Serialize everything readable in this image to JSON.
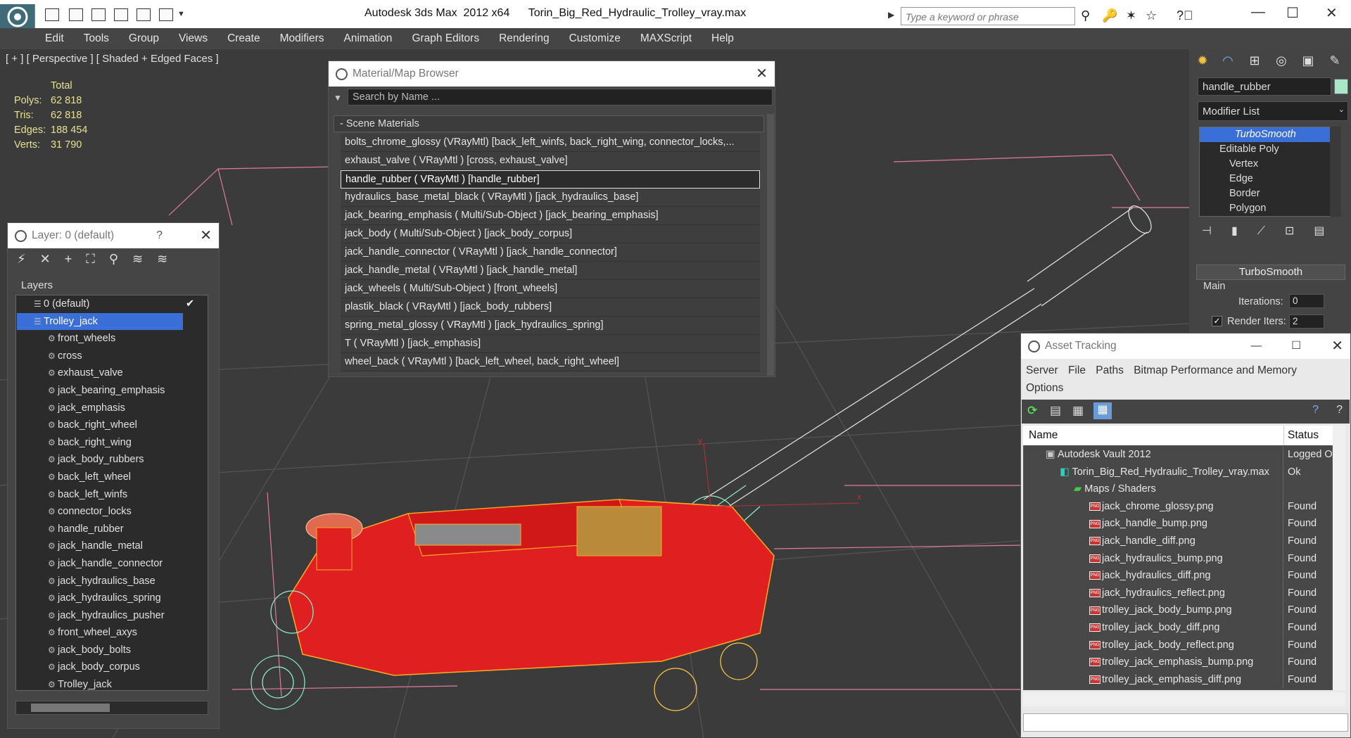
{
  "titlebar": {
    "title": "Autodesk 3ds Max  2012 x64      Torin_Big_Red_Hydraulic_Trolley_vray.max",
    "search_placeholder": "Type a keyword or phrase"
  },
  "menu": [
    "Edit",
    "Tools",
    "Group",
    "Views",
    "Create",
    "Modifiers",
    "Animation",
    "Graph Editors",
    "Rendering",
    "Customize",
    "MAXScript",
    "Help"
  ],
  "viewport": {
    "label": "[ + ] [ Perspective ] [ Shaded + Edged Faces ]",
    "stats_header": "Total",
    "stats": [
      {
        "label": "Polys:",
        "value": "62 818"
      },
      {
        "label": "Tris:",
        "value": "62 818"
      },
      {
        "label": "Edges:",
        "value": "188 454"
      },
      {
        "label": "Verts:",
        "value": "31 790"
      }
    ],
    "axis_x": "x",
    "axis_y": "y"
  },
  "command_panel": {
    "object_name": "handle_rubber",
    "modifier_list": "Modifier List",
    "stack": [
      {
        "label": "TurboSmooth",
        "selected": true
      },
      {
        "label": "Editable Poly",
        "selected": false
      },
      {
        "label": "Vertex",
        "selected": false
      },
      {
        "label": "Edge",
        "selected": false
      },
      {
        "label": "Border",
        "selected": false
      },
      {
        "label": "Polygon",
        "selected": false
      }
    ],
    "rollout_title": "TurboSmooth",
    "group_main": "Main",
    "iterations_label": "Iterations:",
    "iterations_value": "0",
    "render_iters_label": "Render Iters:",
    "render_iters_value": "2"
  },
  "material_browser": {
    "title": "Material/Map Browser",
    "search_placeholder": "Search by Name ...",
    "section": "- Scene Materials",
    "items": [
      "bolts_chrome_glossy (VRayMtl) [back_left_winfs, back_right_wing, connector_locks,...",
      "exhaust_valve  ( VRayMtl ) [cross, exhaust_valve]",
      "handle_rubber  ( VRayMtl ) [handle_rubber]",
      "hydraulics_base_metal_black  ( VRayMtl ) [jack_hydraulics_base]",
      "jack_bearing_emphasis  ( Multi/Sub-Object ) [jack_bearing_emphasis]",
      "jack_body  ( Multi/Sub-Object ) [jack_body_corpus]",
      "jack_handle_connector  ( VRayMtl ) [jack_handle_connector]",
      "jack_handle_metal  ( VRayMtl ) [jack_handle_metal]",
      "jack_wheels  ( Multi/Sub-Object ) [front_wheels]",
      "plastik_black  ( VRayMtl ) [jack_body_rubbers]",
      "spring_metal_glossy  ( VRayMtl ) [jack_hydraulics_spring]",
      "T  ( VRayMtl ) [jack_emphasis]",
      "wheel_back  ( VRayMtl ) [back_left_wheel, back_right_wheel]"
    ],
    "selected_index": 2
  },
  "layer_dialog": {
    "title": "Layer: 0 (default)",
    "help": "?",
    "header": "Layers",
    "layers": [
      {
        "label": "0 (default)",
        "level": 0,
        "selected": false
      },
      {
        "label": "Trolley_jack",
        "level": 0,
        "selected": true
      },
      {
        "label": "front_wheels",
        "level": 1,
        "selected": false
      },
      {
        "label": "cross",
        "level": 1,
        "selected": false
      },
      {
        "label": "exhaust_valve",
        "level": 1,
        "selected": false
      },
      {
        "label": "jack_bearing_emphasis",
        "level": 1,
        "selected": false
      },
      {
        "label": "jack_emphasis",
        "level": 1,
        "selected": false
      },
      {
        "label": "back_right_wheel",
        "level": 1,
        "selected": false
      },
      {
        "label": "back_right_wing",
        "level": 1,
        "selected": false
      },
      {
        "label": "jack_body_rubbers",
        "level": 1,
        "selected": false
      },
      {
        "label": "back_left_wheel",
        "level": 1,
        "selected": false
      },
      {
        "label": "back_left_winfs",
        "level": 1,
        "selected": false
      },
      {
        "label": "connector_locks",
        "level": 1,
        "selected": false
      },
      {
        "label": "handle_rubber",
        "level": 1,
        "selected": false
      },
      {
        "label": "jack_handle_metal",
        "level": 1,
        "selected": false
      },
      {
        "label": "jack_handle_connector",
        "level": 1,
        "selected": false
      },
      {
        "label": "jack_hydraulics_base",
        "level": 1,
        "selected": false
      },
      {
        "label": "jack_hydraulics_spring",
        "level": 1,
        "selected": false
      },
      {
        "label": "jack_hydraulics_pusher",
        "level": 1,
        "selected": false
      },
      {
        "label": "front_wheel_axys",
        "level": 1,
        "selected": false
      },
      {
        "label": "jack_body_bolts",
        "level": 1,
        "selected": false
      },
      {
        "label": "jack_body_corpus",
        "level": 1,
        "selected": false
      },
      {
        "label": "Trolley_jack",
        "level": 1,
        "selected": false
      }
    ]
  },
  "asset_tracking": {
    "title": "Asset Tracking",
    "menu": [
      "Server",
      "File",
      "Paths",
      "Bitmap Performance and Memory",
      "Options"
    ],
    "col_name": "Name",
    "col_status": "Status",
    "rows": [
      {
        "name": "Autodesk Vault 2012",
        "status": "Logged O",
        "level": 1,
        "icon": "vault"
      },
      {
        "name": "Torin_Big_Red_Hydraulic_Trolley_vray.max",
        "status": "Ok",
        "level": 2,
        "icon": "max"
      },
      {
        "name": "Maps / Shaders",
        "status": "",
        "level": 3,
        "icon": "maps"
      },
      {
        "name": "jack_chrome_glossy.png",
        "status": "Found",
        "level": 4,
        "icon": "png"
      },
      {
        "name": "jack_handle_bump.png",
        "status": "Found",
        "level": 4,
        "icon": "png"
      },
      {
        "name": "jack_handle_diff.png",
        "status": "Found",
        "level": 4,
        "icon": "png"
      },
      {
        "name": "jack_hydraulics_bump.png",
        "status": "Found",
        "level": 4,
        "icon": "png"
      },
      {
        "name": "jack_hydraulics_diff.png",
        "status": "Found",
        "level": 4,
        "icon": "png"
      },
      {
        "name": "jack_hydraulics_reflect.png",
        "status": "Found",
        "level": 4,
        "icon": "png"
      },
      {
        "name": "trolley_jack_body_bump.png",
        "status": "Found",
        "level": 4,
        "icon": "png"
      },
      {
        "name": "trolley_jack_body_diff.png",
        "status": "Found",
        "level": 4,
        "icon": "png"
      },
      {
        "name": "trolley_jack_body_reflect.png",
        "status": "Found",
        "level": 4,
        "icon": "png"
      },
      {
        "name": "trolley_jack_emphasis_bump.png",
        "status": "Found",
        "level": 4,
        "icon": "png"
      },
      {
        "name": "trolley_jack_emphasis_diff.png",
        "status": "Found",
        "level": 4,
        "icon": "png"
      }
    ],
    "png_badge": "PNG"
  }
}
